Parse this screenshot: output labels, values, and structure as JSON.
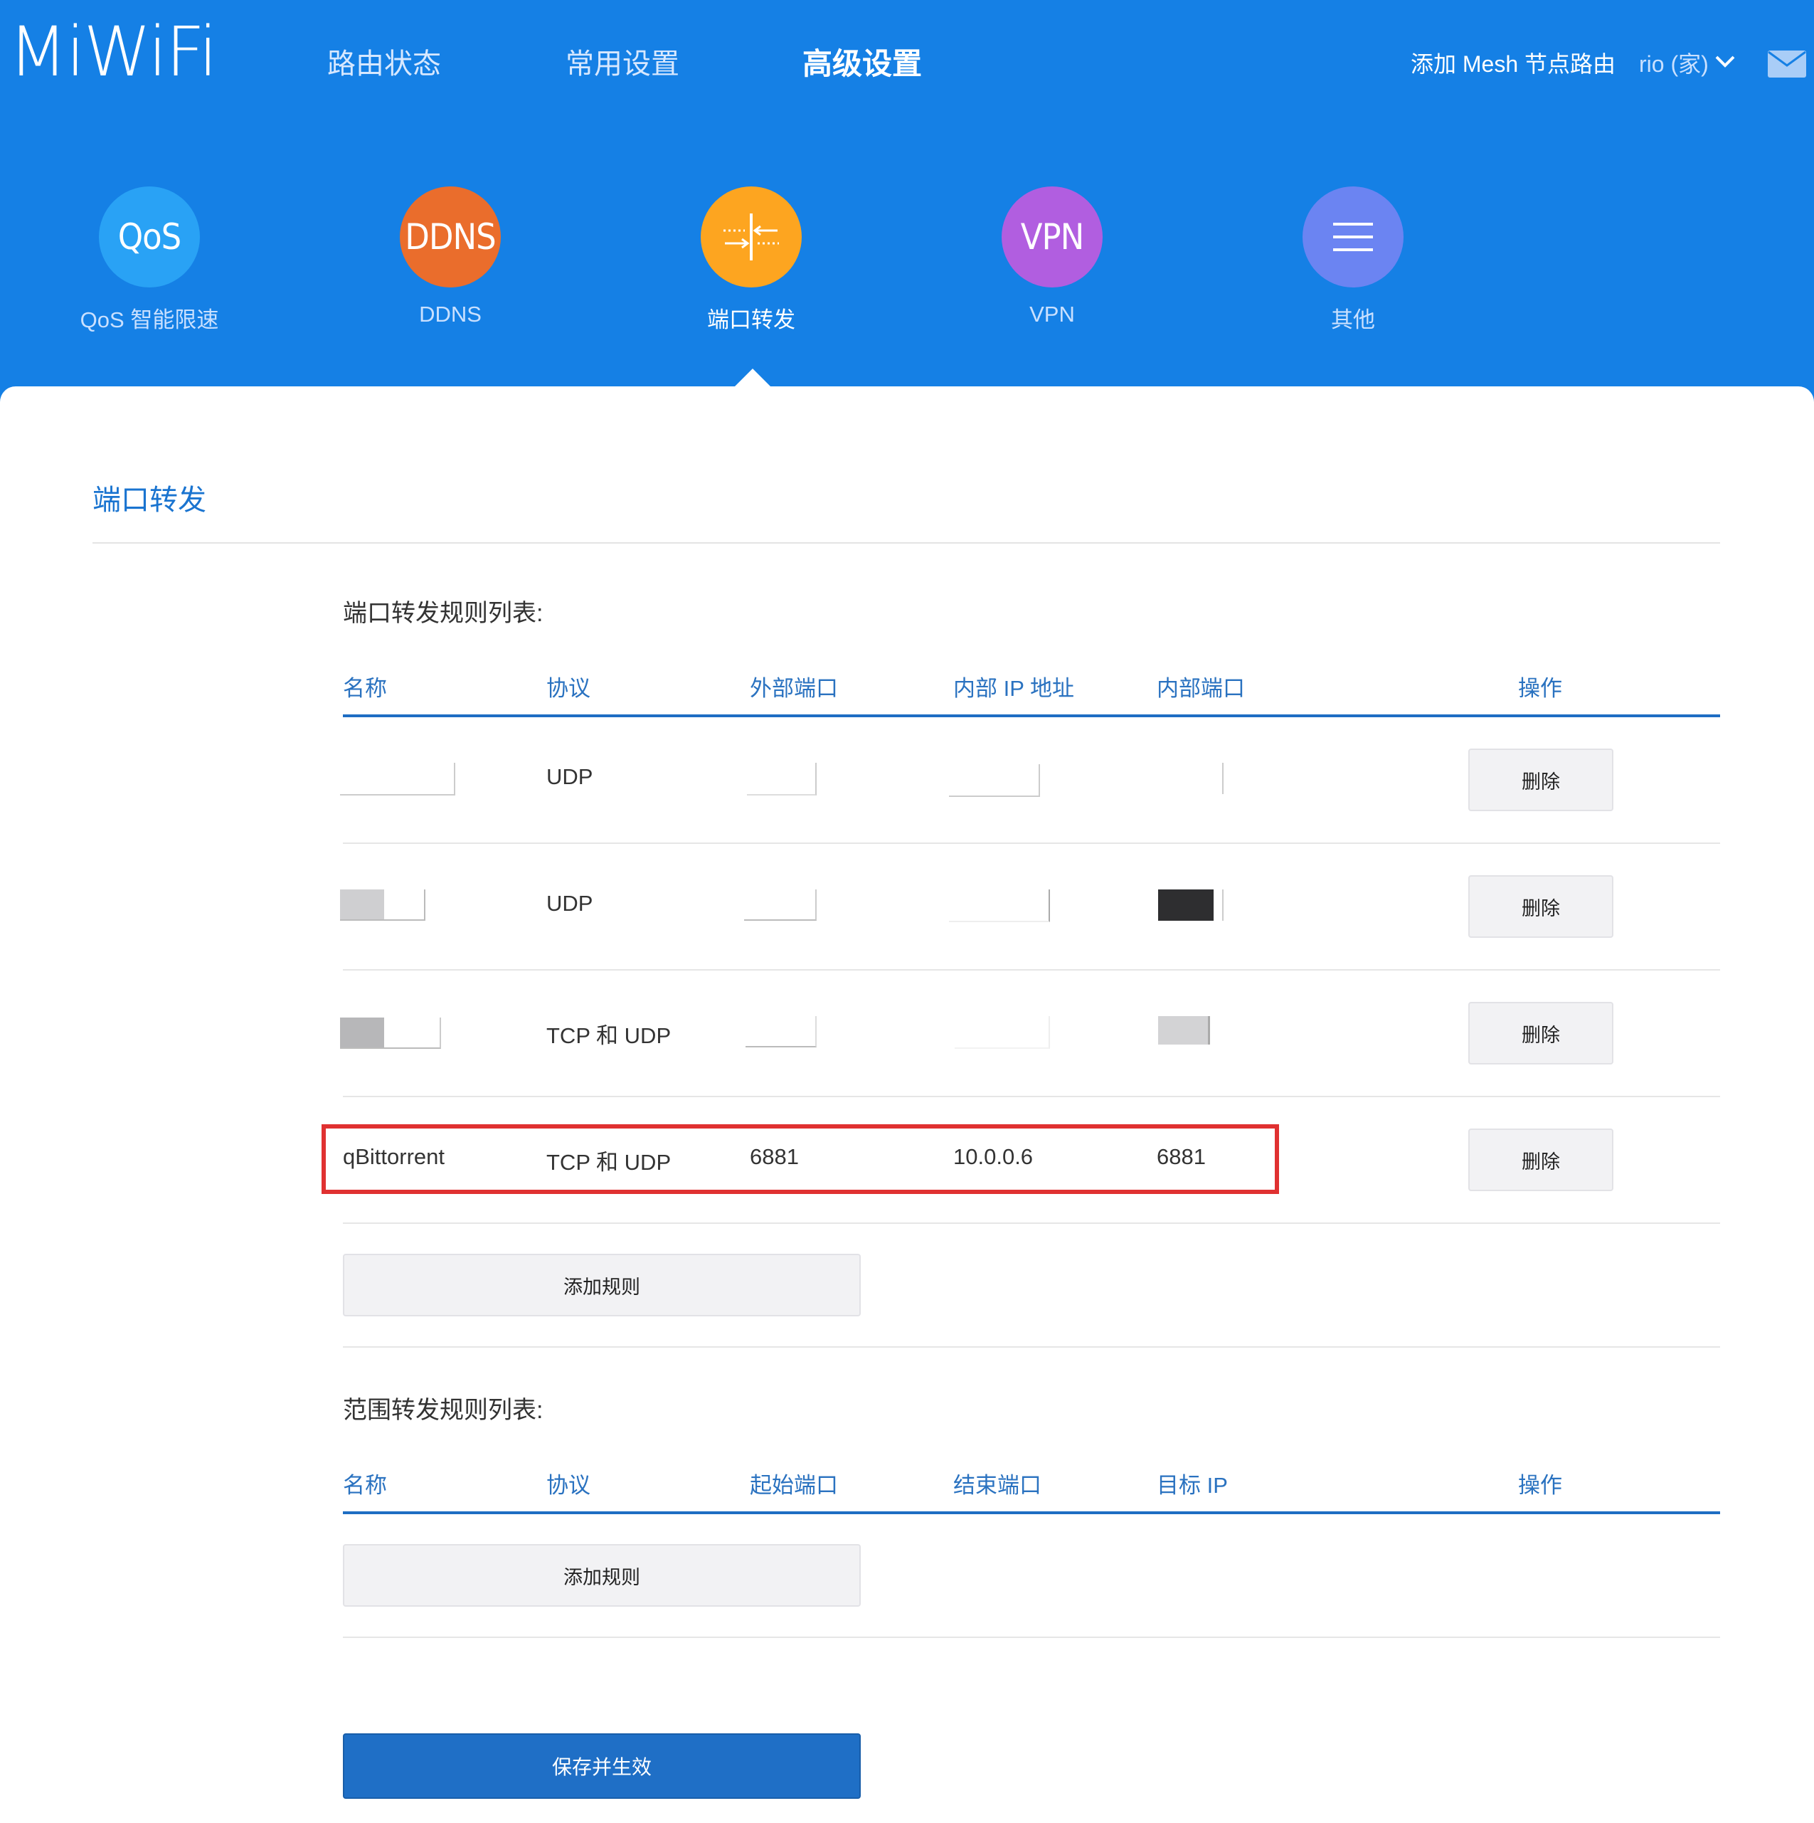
{
  "brand": {
    "logo": "MiWiFi"
  },
  "top_nav": {
    "items": [
      {
        "label": "路由状态"
      },
      {
        "label": "常用设置"
      },
      {
        "label": "高级设置"
      }
    ],
    "active": "高级设置",
    "mesh_link": "添加 Mesh 节点路由",
    "user": "rio (家)"
  },
  "icon_nav": {
    "items": [
      {
        "glyph": "QoS",
        "label": "QoS 智能限速",
        "color": "#29a2f5"
      },
      {
        "glyph": "DDNS",
        "label": "DDNS",
        "color": "#ea6d2c"
      },
      {
        "glyph": "",
        "label": "端口转发",
        "color": "#fda520"
      },
      {
        "glyph": "VPN",
        "label": "VPN",
        "color": "#b15ee0"
      },
      {
        "glyph": "",
        "label": "其他",
        "color": "#6b84f2"
      }
    ],
    "active": "端口转发"
  },
  "page": {
    "title": "端口转发"
  },
  "port_forward": {
    "title": "端口转发规则列表:",
    "columns": [
      "名称",
      "协议",
      "外部端口",
      "内部 IP 地址",
      "内部端口",
      "操作"
    ],
    "rows": [
      {
        "name": "",
        "protocol": "UDP",
        "ext_port": "",
        "int_ip": "",
        "int_port": "",
        "action": "删除"
      },
      {
        "name": "",
        "protocol": "UDP",
        "ext_port": "",
        "int_ip": "",
        "int_port": "",
        "action": "删除"
      },
      {
        "name": "",
        "protocol": "TCP 和 UDP",
        "ext_port": "",
        "int_ip": "",
        "int_port": "",
        "action": "删除"
      },
      {
        "name": "qBittorrent",
        "protocol": "TCP 和 UDP",
        "ext_port": "6881",
        "int_ip": "10.0.0.6",
        "int_port": "6881",
        "action": "删除"
      }
    ],
    "add_button": "添加规则"
  },
  "range_forward": {
    "title": "范围转发规则列表:",
    "columns": [
      "名称",
      "协议",
      "起始端口",
      "结束端口",
      "目标 IP",
      "操作"
    ],
    "add_button": "添加规则"
  },
  "save_button": "保存并生效",
  "colors": {
    "header_bg": "#1580e5",
    "link_blue": "#1a74d0",
    "primary_button": "#1f6fc6",
    "highlight_red": "#e03131"
  }
}
